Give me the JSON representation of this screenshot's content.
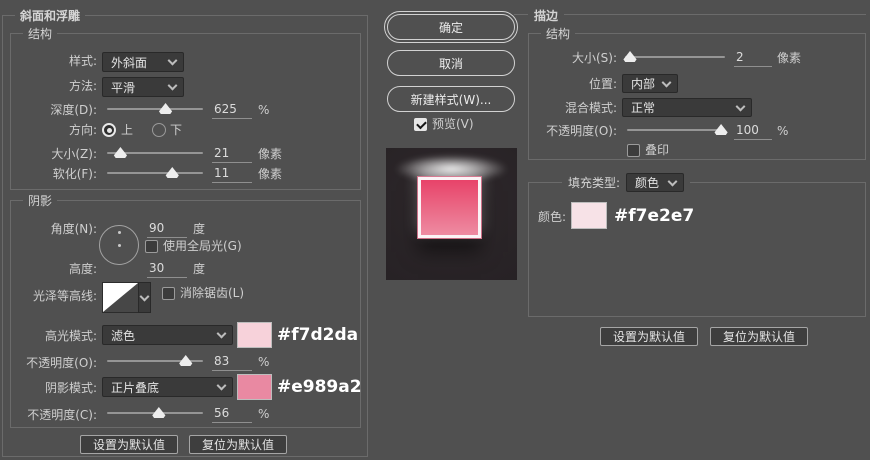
{
  "colors": {
    "dialog_bg": "#505050",
    "highlight_swatch": "#f7d2da",
    "shadow_swatch": "#e989a2",
    "stroke_color_swatch": "#f7e2e7"
  },
  "bevel_panel": {
    "title": "斜面和浮雕",
    "structure": {
      "title": "结构",
      "style_label": "样式:",
      "style_value": "外斜面",
      "method_label": "方法:",
      "method_value": "平滑",
      "depth_label": "深度(D):",
      "depth_value": "625",
      "depth_unit": "%",
      "direction_label": "方向:",
      "direction_up_label": "上",
      "direction_down_label": "下",
      "size_label": "大小(Z):",
      "size_value": "21",
      "size_unit": "像素",
      "soften_label": "软化(F):",
      "soften_value": "11",
      "soften_unit": "像素"
    },
    "shading": {
      "title": "阴影",
      "angle_label": "角度(N):",
      "angle_value": "90",
      "angle_unit": "度",
      "use_global_light_label": "使用全局光(G)",
      "altitude_label": "高度:",
      "altitude_value": "30",
      "altitude_unit": "度",
      "gloss_contour_label": "光泽等高线:",
      "anti_alias_label": "消除锯齿(L)",
      "highlight_mode_label": "高光模式:",
      "highlight_mode_value": "滤色",
      "highlight_color_annotation": "#f7d2da",
      "highlight_opacity_label": "不透明度(O):",
      "highlight_opacity_value": "83",
      "highlight_opacity_unit": "%",
      "shadow_mode_label": "阴影模式:",
      "shadow_mode_value": "正片叠底",
      "shadow_color_annotation": "#e989a2",
      "shadow_opacity_label": "不透明度(C):",
      "shadow_opacity_value": "56",
      "shadow_opacity_unit": "%"
    },
    "set_default_button": "设置为默认值",
    "reset_default_button": "复位为默认值"
  },
  "action_column": {
    "ok_button": "确定",
    "cancel_button": "取消",
    "new_style_button": "新建样式(W)...",
    "preview_checkbox_label": "预览(V)"
  },
  "stroke_panel": {
    "title": "描边",
    "structure": {
      "title": "结构",
      "size_label": "大小(S):",
      "size_value": "2",
      "size_unit": "像素",
      "position_label": "位置:",
      "position_value": "内部",
      "blend_mode_label": "混合模式:",
      "blend_mode_value": "正常",
      "opacity_label": "不透明度(O):",
      "opacity_value": "100",
      "opacity_unit": "%",
      "overprint_label": "叠印"
    },
    "fill": {
      "fill_type_label": "填充类型:",
      "fill_type_value": "颜色",
      "color_label": "颜色:",
      "color_annotation": "#f7e2e7"
    },
    "set_default_button": "设置为默认值",
    "reset_default_button": "复位为默认值"
  }
}
